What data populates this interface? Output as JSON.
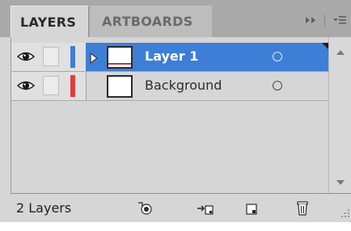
{
  "tabs": [
    {
      "label": "LAYERS",
      "active": true
    },
    {
      "label": "ARTBOARDS",
      "active": false
    }
  ],
  "panel_controls": {
    "collapse_icon": "double-chevron-right-icon",
    "menu_icon": "panel-menu-icon"
  },
  "layers": [
    {
      "name": "Layer 1",
      "selected": true,
      "visible": true,
      "locked": false,
      "color": "#3d7fd6",
      "expandable": true,
      "thumb_stripe": "#cc3333"
    },
    {
      "name": "Background",
      "selected": false,
      "visible": true,
      "locked": false,
      "color": "#e33b3b",
      "expandable": false,
      "thumb_stripe": ""
    }
  ],
  "footer": {
    "count_label": "2 Layers",
    "buttons": [
      "make-clipping-mask-icon",
      "move-to-layer-icon",
      "new-layer-icon",
      "delete-layer-icon"
    ]
  },
  "colors": {
    "selection": "#3d7fd6",
    "panel_bg": "#d6d6d6",
    "tab_bar_bg": "#a9a9a9"
  }
}
